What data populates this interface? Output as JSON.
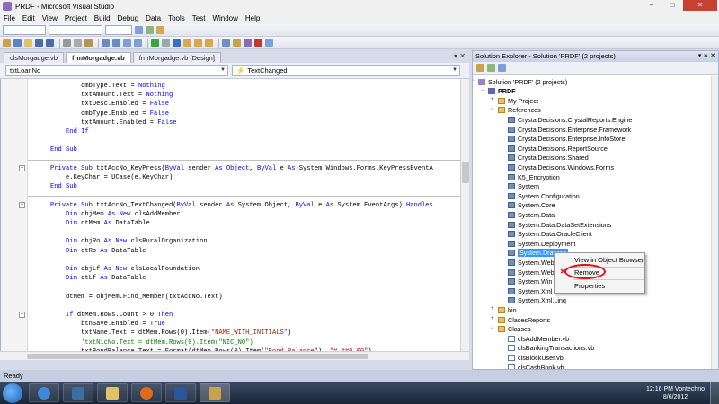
{
  "window": {
    "title": "PRDF - Microsoft Visual Studio"
  },
  "menu": [
    "File",
    "Edit",
    "View",
    "Project",
    "Build",
    "Debug",
    "Data",
    "Tools",
    "Test",
    "Window",
    "Help"
  ],
  "tabs": [
    {
      "label": "clsMorgadge.vb",
      "active": false
    },
    {
      "label": "frmMorgadge.vb",
      "active": true
    },
    {
      "label": "frmMorgadge.vb [Design]",
      "active": false
    }
  ],
  "nav": {
    "object": "txtLoanNo",
    "event": "TextChanged"
  },
  "code": [
    {
      "t": [
        [
          "",
          "            cmbType.Text = "
        ],
        [
          "kw",
          "Nothing"
        ]
      ]
    },
    {
      "t": [
        [
          "",
          "            txtAmount.Text = "
        ],
        [
          "kw",
          "Nothing"
        ]
      ]
    },
    {
      "t": [
        [
          "",
          "            txtDesc.Enabled = "
        ],
        [
          "kw",
          "False"
        ]
      ]
    },
    {
      "t": [
        [
          "",
          "            cmbType.Enabled = "
        ],
        [
          "kw",
          "False"
        ]
      ]
    },
    {
      "t": [
        [
          "",
          "            txtAmount.Enabled = "
        ],
        [
          "kw",
          "False"
        ]
      ]
    },
    {
      "t": [
        [
          "kw",
          "        End If"
        ]
      ]
    },
    {
      "t": [
        [
          "",
          ""
        ]
      ]
    },
    {
      "t": [
        [
          "kw",
          "    End Sub"
        ]
      ]
    },
    {
      "t": [
        [
          "",
          ""
        ]
      ]
    },
    {
      "t": [
        [
          "kw",
          "    Private Sub"
        ],
        [
          "",
          " txtAccNo_KeyPress("
        ],
        [
          "kw",
          "ByVal"
        ],
        [
          "",
          " sender "
        ],
        [
          "kw",
          "As Object"
        ],
        [
          "",
          ", "
        ],
        [
          "kw",
          "ByVal"
        ],
        [
          "",
          " e "
        ],
        [
          "kw",
          "As"
        ],
        [
          "",
          " System.Windows.Forms.KeyPressEventA"
        ]
      ]
    },
    {
      "t": [
        [
          "",
          "        e.KeyChar = UCase(e.KeyChar)"
        ]
      ]
    },
    {
      "t": [
        [
          "kw",
          "    End Sub"
        ]
      ]
    },
    {
      "t": [
        [
          "",
          ""
        ]
      ]
    },
    {
      "t": [
        [
          "kw",
          "    Private Sub"
        ],
        [
          "",
          " txtAccNo_TextChanged("
        ],
        [
          "kw",
          "ByVal"
        ],
        [
          "",
          " sender "
        ],
        [
          "kw",
          "As"
        ],
        [
          "",
          " System.Object, "
        ],
        [
          "kw",
          "ByVal"
        ],
        [
          "",
          " e "
        ],
        [
          "kw",
          "As"
        ],
        [
          "",
          " System.EventArgs) "
        ],
        [
          "kw",
          "Handles"
        ]
      ]
    },
    {
      "t": [
        [
          "kw",
          "        Dim"
        ],
        [
          "",
          " objMem "
        ],
        [
          "kw",
          "As New"
        ],
        [
          "",
          " clsAddMember"
        ]
      ]
    },
    {
      "t": [
        [
          "kw",
          "        Dim"
        ],
        [
          "",
          " dtMem "
        ],
        [
          "kw",
          "As"
        ],
        [
          "",
          " DataTable"
        ]
      ]
    },
    {
      "t": [
        [
          "",
          ""
        ]
      ]
    },
    {
      "t": [
        [
          "kw",
          "        Dim"
        ],
        [
          "",
          " objRo "
        ],
        [
          "kw",
          "As New"
        ],
        [
          "",
          " clsRuralOrganization"
        ]
      ]
    },
    {
      "t": [
        [
          "kw",
          "        Dim"
        ],
        [
          "",
          " dtRo "
        ],
        [
          "kw",
          "As"
        ],
        [
          "",
          " DataTable"
        ]
      ]
    },
    {
      "t": [
        [
          "",
          ""
        ]
      ]
    },
    {
      "t": [
        [
          "kw",
          "        Dim"
        ],
        [
          "",
          " objLf "
        ],
        [
          "kw",
          "As New"
        ],
        [
          "",
          " clsLocalFoundation"
        ]
      ]
    },
    {
      "t": [
        [
          "kw",
          "        Dim"
        ],
        [
          "",
          " dtLf "
        ],
        [
          "kw",
          "As"
        ],
        [
          "",
          " DataTable"
        ]
      ]
    },
    {
      "t": [
        [
          "",
          ""
        ]
      ]
    },
    {
      "t": [
        [
          "",
          "        dtMem = objMem.Find_Member(txtAccNo.Text)"
        ]
      ]
    },
    {
      "t": [
        [
          "",
          ""
        ]
      ]
    },
    {
      "t": [
        [
          "kw",
          "        If"
        ],
        [
          "",
          " dtMem.Rows.Count > 0 "
        ],
        [
          "kw",
          "Then"
        ]
      ]
    },
    {
      "t": [
        [
          "",
          "            btnSave.Enabled = "
        ],
        [
          "kw",
          "True"
        ]
      ]
    },
    {
      "t": [
        [
          "",
          "            txtName.Text = dtMem.Rows(0).Item("
        ],
        [
          "str",
          "\"NAME_WITH_INITIALS\""
        ],
        [
          "",
          ")"
        ]
      ]
    },
    {
      "t": [
        [
          "cmt",
          "            'txtNicNo.Text = dtMem.Rows(0).Item(\"NIC_NO\")"
        ]
      ]
    },
    {
      "t": [
        [
          "",
          "            txtBondBalance.Text = Format(dtMem.Rows(0).Item("
        ],
        [
          "str",
          "\"Bond_Balance\""
        ],
        [
          "",
          "), "
        ],
        [
          "str",
          "\"#,##0.00\""
        ],
        [
          "",
          ")"
        ]
      ]
    }
  ],
  "solution": {
    "title": "Solution Explorer - Solution 'PRDF' (2 projects)",
    "items": [
      {
        "label": "Solution 'PRDF' (2 projects)",
        "icon": "sol",
        "indent": 0
      },
      {
        "label": "PRDF",
        "icon": "proj",
        "indent": 1,
        "bold": true
      },
      {
        "label": "My Project",
        "icon": "folder",
        "indent": 2
      },
      {
        "label": "References",
        "icon": "folder",
        "indent": 2
      },
      {
        "label": "CrystalDecisions.CrystalReports.Engine",
        "icon": "ref",
        "indent": 3
      },
      {
        "label": "CrystalDecisions.Enterprise.Framework",
        "icon": "ref",
        "indent": 3
      },
      {
        "label": "CrystalDecisions.Enterprise.InfoStore",
        "icon": "ref",
        "indent": 3
      },
      {
        "label": "CrystalDecisions.ReportSource",
        "icon": "ref",
        "indent": 3
      },
      {
        "label": "CrystalDecisions.Shared",
        "icon": "ref",
        "indent": 3
      },
      {
        "label": "CrystalDecisions.Windows.Forms",
        "icon": "ref",
        "indent": 3
      },
      {
        "label": "K5_Encryption",
        "icon": "ref",
        "indent": 3
      },
      {
        "label": "System",
        "icon": "ref",
        "indent": 3
      },
      {
        "label": "System.Configuration",
        "icon": "ref",
        "indent": 3
      },
      {
        "label": "System.Core",
        "icon": "ref",
        "indent": 3
      },
      {
        "label": "System.Data",
        "icon": "ref",
        "indent": 3
      },
      {
        "label": "System.Data.DataSetExtensions",
        "icon": "ref",
        "indent": 3
      },
      {
        "label": "System.Data.OracleClient",
        "icon": "ref",
        "indent": 3
      },
      {
        "label": "System.Deployment",
        "icon": "ref",
        "indent": 3
      },
      {
        "label": "System.Drawing",
        "icon": "ref",
        "indent": 3,
        "selected": true
      },
      {
        "label": "System.Web",
        "icon": "ref",
        "indent": 3
      },
      {
        "label": "System.Web",
        "icon": "ref",
        "indent": 3
      },
      {
        "label": "System.Win",
        "icon": "ref",
        "indent": 3
      },
      {
        "label": "System.Xml",
        "icon": "ref",
        "indent": 3
      },
      {
        "label": "System.Xml.Linq",
        "icon": "ref",
        "indent": 3
      },
      {
        "label": "bin",
        "icon": "folder",
        "indent": 2
      },
      {
        "label": "ClasesReports",
        "icon": "folder",
        "indent": 2
      },
      {
        "label": "Classes",
        "icon": "folder",
        "indent": 2
      },
      {
        "label": "clsAddMember.vb",
        "icon": "vb",
        "indent": 3
      },
      {
        "label": "clsBankingTransactions.vb",
        "icon": "vb",
        "indent": 3
      },
      {
        "label": "clsBlockUser.vb",
        "icon": "vb",
        "indent": 3
      },
      {
        "label": "clsCashBook.vb",
        "icon": "vb",
        "indent": 3
      }
    ]
  },
  "context_menu": {
    "items": [
      "View in Object Browser",
      "Remove",
      "Properties"
    ]
  },
  "status": {
    "text": "Ready"
  },
  "taskbar": {
    "clock_time": "12:16 PM Vontechno",
    "clock_date": "8/6/2012"
  },
  "colors": {
    "keyword": "#0000ff",
    "string": "#a31515",
    "comment": "#008000",
    "selection": "#3399ff",
    "highlight_circle": "#e0101a"
  }
}
